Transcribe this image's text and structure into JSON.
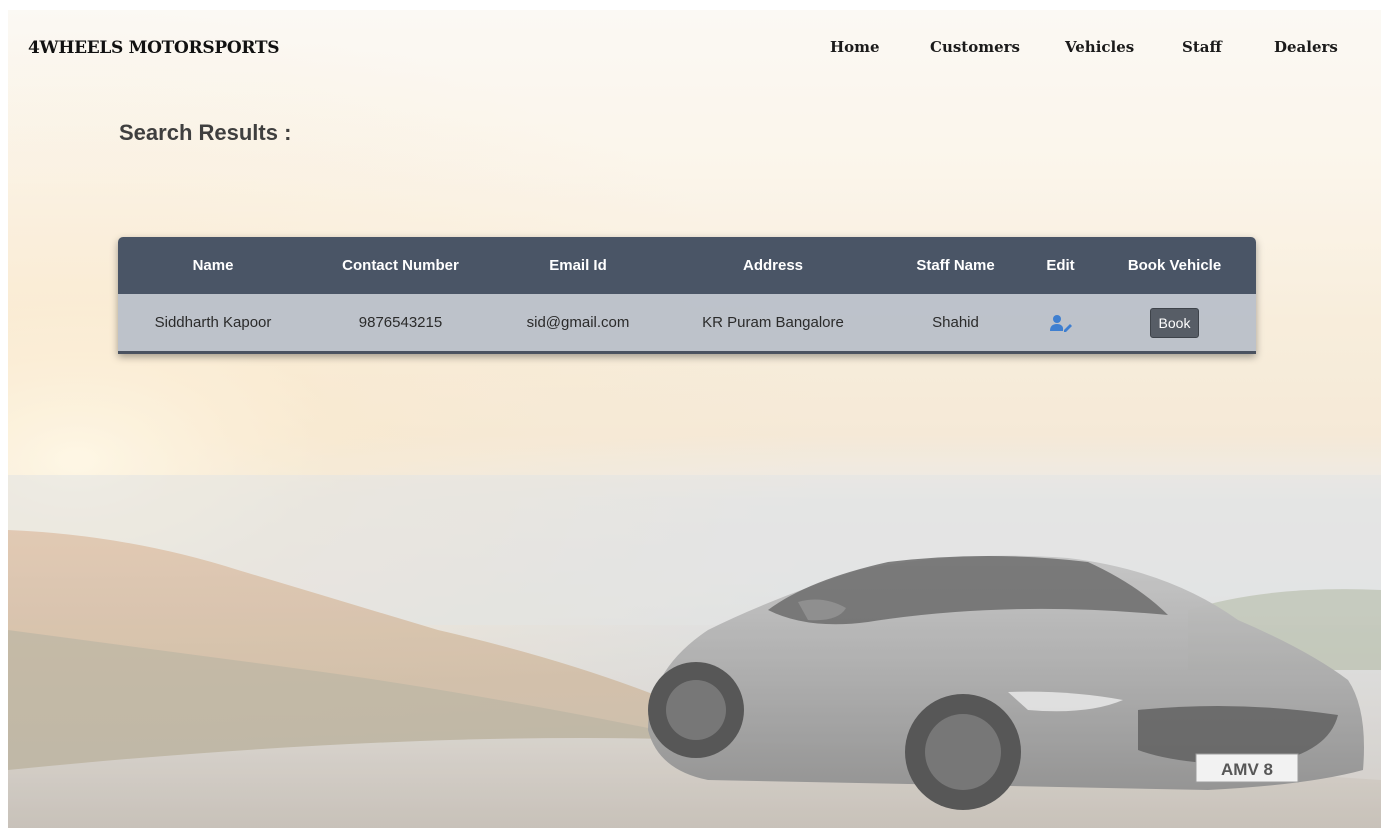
{
  "brand": {
    "name": "4WHEELS MOTORSPORTS"
  },
  "nav": {
    "items": [
      {
        "label": "Home"
      },
      {
        "label": "Customers"
      },
      {
        "label": "Vehicles"
      },
      {
        "label": "Staff"
      },
      {
        "label": "Dealers"
      }
    ]
  },
  "page": {
    "title": "Search Results :"
  },
  "table": {
    "headers": [
      "Name",
      "Contact Number",
      "Email Id",
      "Address",
      "Staff Name",
      "Edit",
      "Book Vehicle"
    ],
    "rows": [
      {
        "name": "Siddharth Kapoor",
        "contact": "9876543215",
        "email": "sid@gmail.com",
        "address": "KR Puram Bangalore",
        "staff": "Shahid",
        "edit_icon": "user-edit-icon",
        "book_label": "Book"
      }
    ]
  },
  "background": {
    "description_icon": "sports-car-photo",
    "plate_text": "AMV 8"
  },
  "colors": {
    "table_header": "#4a5566",
    "table_row": "#b7bec9",
    "edit_icon": "#3f7fd0",
    "book_button": "#575d66"
  }
}
